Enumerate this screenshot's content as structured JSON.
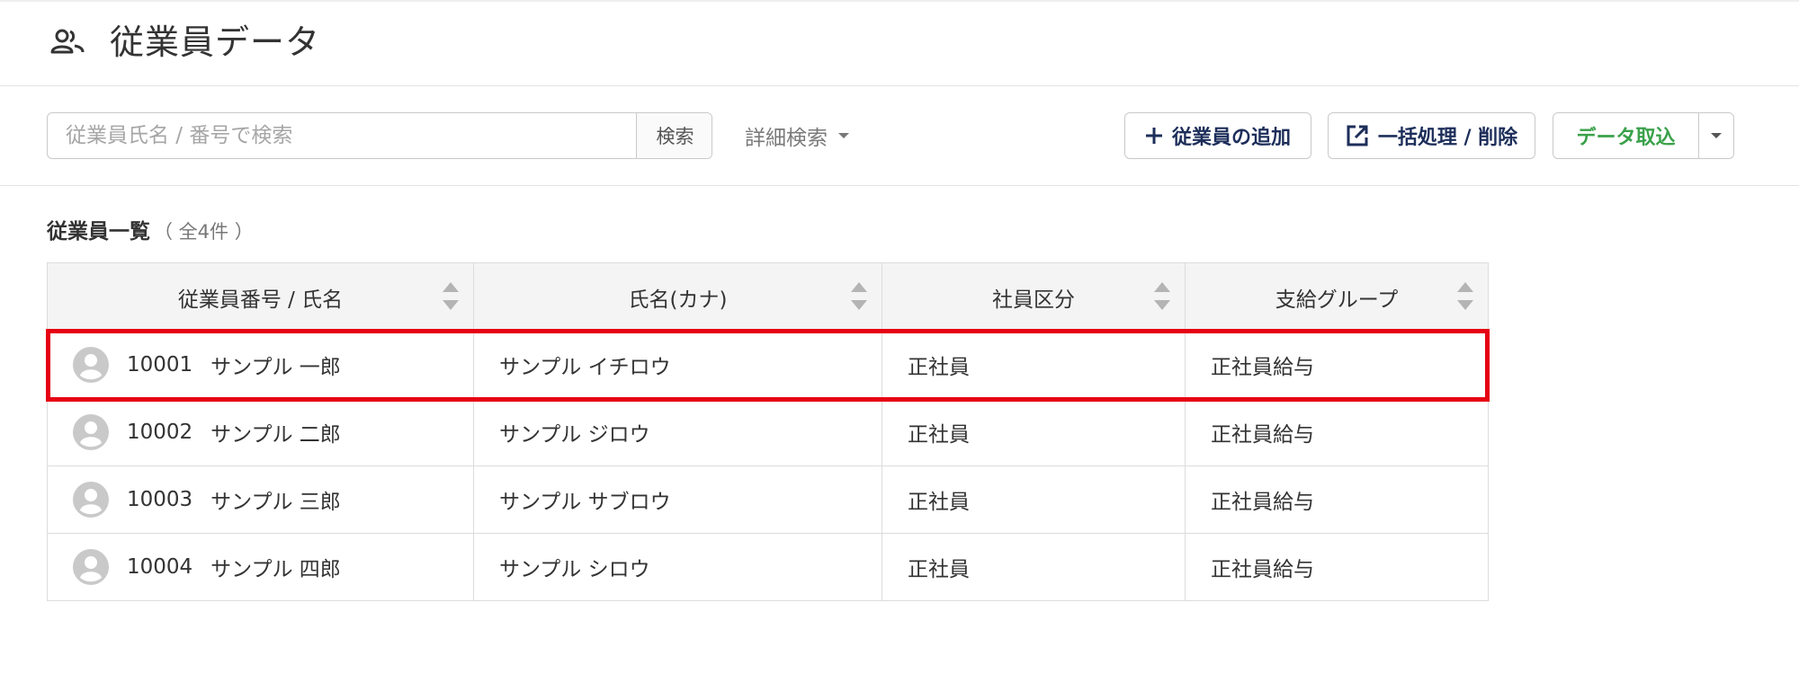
{
  "header": {
    "title": "従業員データ",
    "icon": "users-icon"
  },
  "toolbar": {
    "search_placeholder": "従業員氏名 / 番号で検索",
    "search_button": "検索",
    "advanced_search": "詳細検索",
    "add_employee": "従業員の追加",
    "bulk_action": "一括処理 / 削除",
    "import_data": "データ取込"
  },
  "list": {
    "title": "従業員一覧",
    "count": "（ 全4件 ）",
    "columns": [
      "従業員番号 / 氏名",
      "氏名(カナ)",
      "社員区分",
      "支給グループ"
    ],
    "rows": [
      {
        "id": "10001",
        "name": "サンプル 一郎",
        "kana": "サンプル イチロウ",
        "type": "正社員",
        "group": "正社員給与"
      },
      {
        "id": "10002",
        "name": "サンプル 二郎",
        "kana": "サンプル ジロウ",
        "type": "正社員",
        "group": "正社員給与"
      },
      {
        "id": "10003",
        "name": "サンプル 三郎",
        "kana": "サンプル サブロウ",
        "type": "正社員",
        "group": "正社員給与"
      },
      {
        "id": "10004",
        "name": "サンプル 四郎",
        "kana": "サンプル シロウ",
        "type": "正社員",
        "group": "正社員給与"
      }
    ]
  },
  "colors": {
    "highlight": "#e60012",
    "import_accent": "#3aa14a",
    "button_text": "#1d2e5a"
  }
}
